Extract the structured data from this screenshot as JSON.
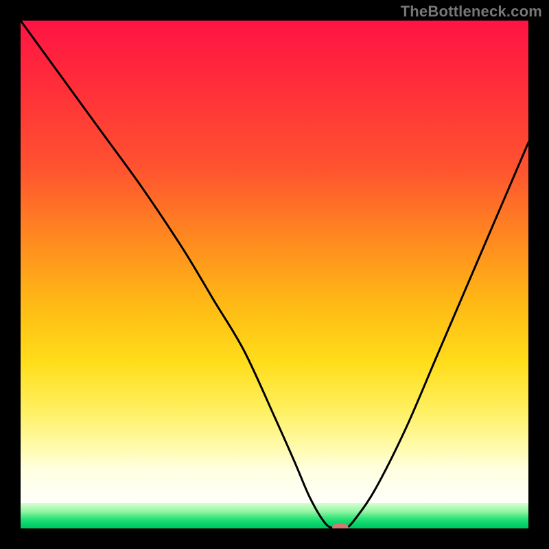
{
  "watermark": "TheBottleneck.com",
  "chart_data": {
    "type": "line",
    "title": "",
    "xlabel": "",
    "ylabel": "",
    "xlim": [
      0,
      100
    ],
    "ylim": [
      0,
      100
    ],
    "grid": false,
    "legend": false,
    "gradient_stops": [
      {
        "pos": 0,
        "color": "#ff1444"
      },
      {
        "pos": 12,
        "color": "#ff2b3a"
      },
      {
        "pos": 30,
        "color": "#ff5230"
      },
      {
        "pos": 45,
        "color": "#ff8a1f"
      },
      {
        "pos": 58,
        "color": "#ffb915"
      },
      {
        "pos": 70,
        "color": "#ffdd1a"
      },
      {
        "pos": 80,
        "color": "#fff060"
      },
      {
        "pos": 88,
        "color": "#fffbb0"
      },
      {
        "pos": 92,
        "color": "#ffffe0"
      },
      {
        "pos": 96,
        "color": "#ffffff"
      },
      {
        "pos": 97,
        "color": "#8ef5a0"
      },
      {
        "pos": 100,
        "color": "#00c463"
      }
    ],
    "series": [
      {
        "name": "bottleneck-curve",
        "x": [
          0,
          8,
          16,
          24,
          32,
          38,
          44,
          50,
          54,
          57,
          60,
          62,
          64,
          66,
          70,
          76,
          82,
          88,
          94,
          100
        ],
        "y": [
          100,
          89,
          78,
          67,
          55,
          45,
          35,
          22,
          13,
          6,
          1,
          0,
          0,
          2,
          8,
          20,
          34,
          48,
          62,
          76
        ]
      }
    ],
    "marker": {
      "x": 63,
      "y": 0,
      "color": "#cf7b74"
    }
  }
}
